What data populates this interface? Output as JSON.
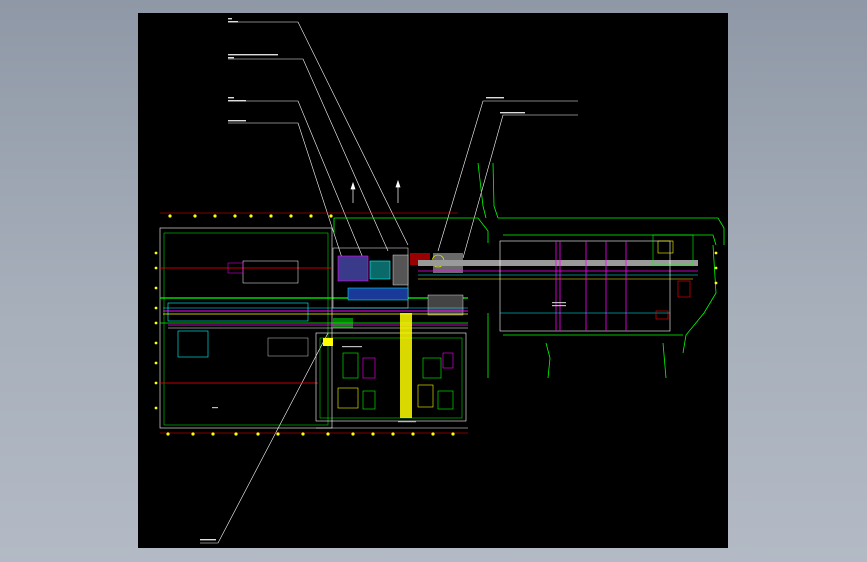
{
  "viewer": {
    "background_color": "#000000",
    "frame_color": "#9aa3b0"
  },
  "drawing": {
    "layer_colors": {
      "walls": "#00ff00",
      "axis": "#ff0000",
      "pipes": "#ff00ff",
      "equipment": "#ffff00",
      "ducts": "#00ffff",
      "roads": "#00ff00",
      "leaders": "#ffffff",
      "building": "#ffffff"
    },
    "north_arrow_count": 2
  }
}
